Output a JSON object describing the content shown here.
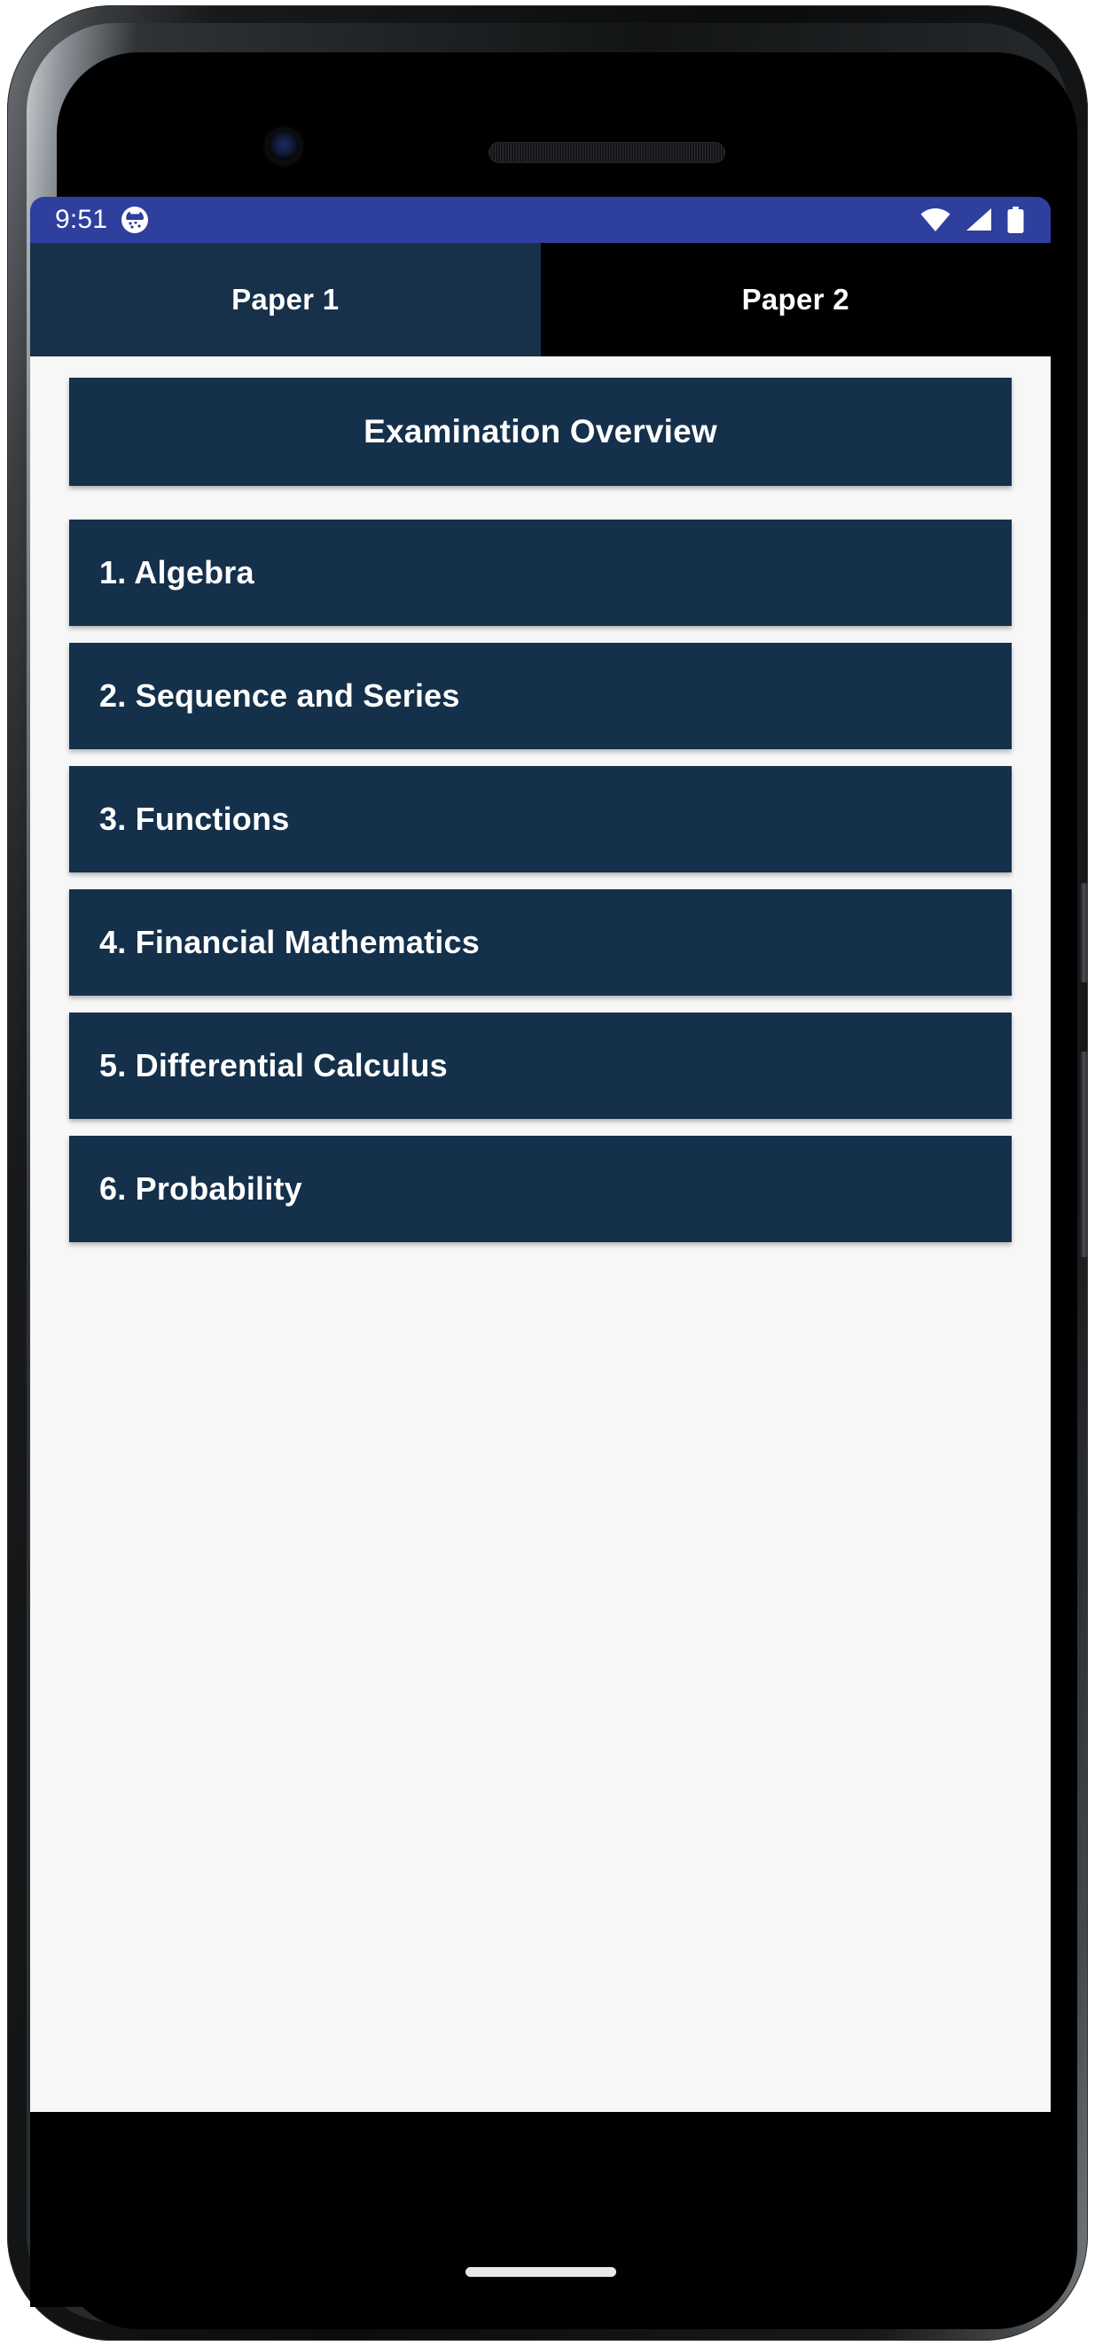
{
  "device": {
    "frame": "android-phone",
    "camera": "front-camera",
    "speaker": "earpiece-speaker",
    "power_button": "power-button",
    "volume_button": "volume-button"
  },
  "status_bar": {
    "time": "9:51",
    "notification_icon": "app-notification-icon",
    "icons": [
      "wifi-icon",
      "cellular-signal-icon",
      "battery-icon"
    ],
    "background_color": "#2F3F9E",
    "text_color": "#FFFFFF"
  },
  "tabs": {
    "active_index": 0,
    "items": [
      {
        "label": "Paper 1",
        "active": true
      },
      {
        "label": "Paper 2",
        "active": false
      }
    ],
    "active_background": "#17314A",
    "inactive_background": "#000000"
  },
  "header": {
    "title": "Examination Overview",
    "background_color": "#14304B"
  },
  "topics": {
    "background_color": "#14304B",
    "items": [
      {
        "label": "1. Algebra"
      },
      {
        "label": "2. Sequence and Series"
      },
      {
        "label": "3. Functions"
      },
      {
        "label": "4. Financial Mathematics"
      },
      {
        "label": "5. Differential Calculus"
      },
      {
        "label": "6. Probability"
      }
    ]
  },
  "content": {
    "background_color": "#F7F7F7"
  },
  "navigation": {
    "gesture_pill": "home-gesture-pill"
  }
}
